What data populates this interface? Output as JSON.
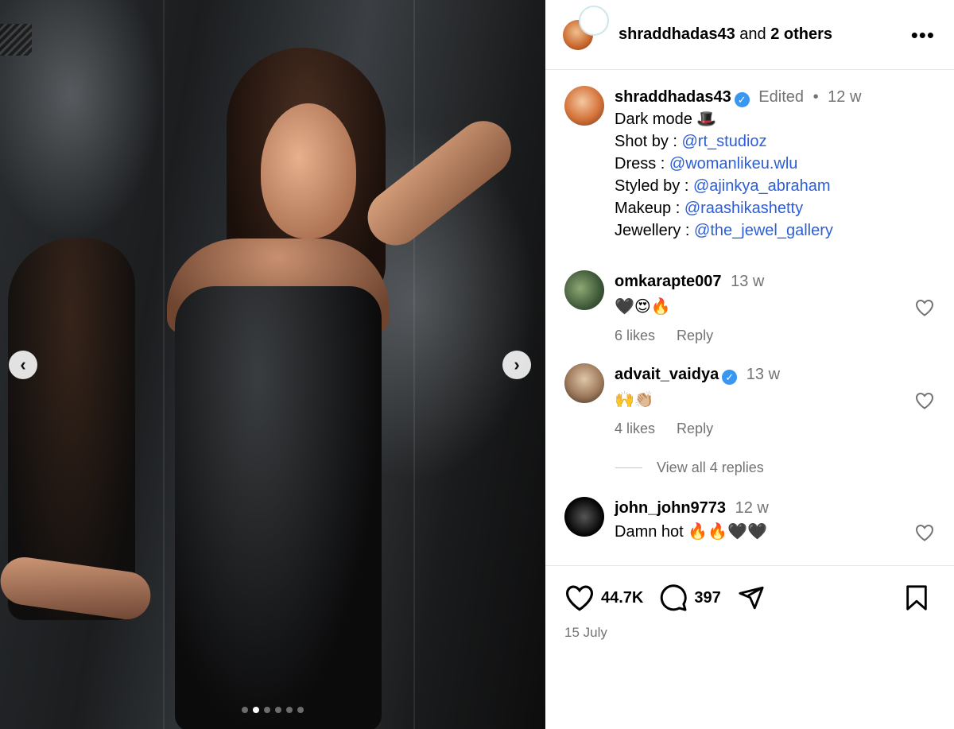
{
  "header": {
    "username": "shraddhadas43",
    "connector": " and ",
    "others": "2 others"
  },
  "caption": {
    "username": "shraddhadas43",
    "edited": "Edited",
    "separator": "•",
    "time": "12 w",
    "lines": [
      {
        "text": "Dark mode 🎩",
        "handle": ""
      },
      {
        "text": "Shot by : ",
        "handle": "@rt_studioz"
      },
      {
        "text": "Dress : ",
        "handle": "@womanlikeu.wlu"
      },
      {
        "text": "Styled by : ",
        "handle": "@ajinkya_abraham"
      },
      {
        "text": "Makeup : ",
        "handle": "@raashikashetty"
      },
      {
        "text": "Jewellery : ",
        "handle": "@the_jewel_gallery"
      }
    ]
  },
  "comments": [
    {
      "username": "omkarapte007",
      "verified": false,
      "time": "13 w",
      "text": "🖤😍🔥",
      "likes": "6 likes",
      "reply": "Reply"
    },
    {
      "username": "advait_vaidya",
      "verified": true,
      "time": "13 w",
      "text": "🙌👏🏼",
      "likes": "4 likes",
      "reply": "Reply"
    },
    {
      "username": "john_john9773",
      "verified": false,
      "time": "12 w",
      "text": "Damn hot 🔥🔥🖤🖤"
    }
  ],
  "view_replies": "View all 4 replies",
  "footer": {
    "likes_count": "44.7K",
    "comments_count": "397",
    "date": "15 July"
  },
  "carousel": {
    "total": 6,
    "active_index": 1
  },
  "colors": {
    "link": "#2b5ed8",
    "muted": "#737373",
    "verified": "#3897f0"
  }
}
